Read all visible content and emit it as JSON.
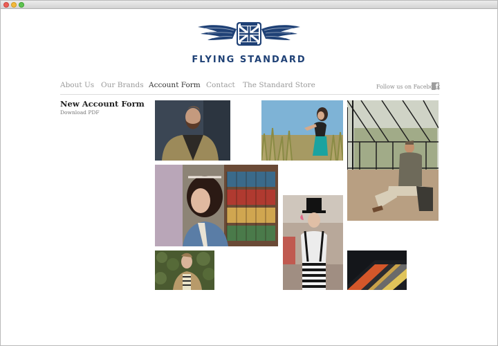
{
  "window": {
    "traffic_lights": [
      "close",
      "minimize",
      "zoom"
    ]
  },
  "site": {
    "name": "FLYING STANDARD",
    "logo": "winged-union-jack-emblem"
  },
  "nav": {
    "items": [
      {
        "label": "About Us",
        "active": false
      },
      {
        "label": "Our Brands",
        "active": false
      },
      {
        "label": "Account Form",
        "active": true
      },
      {
        "label": "Contact",
        "active": false
      },
      {
        "label": "The Standard Store",
        "active": false
      }
    ],
    "active_color": "#333333",
    "inactive_color": "#9a9a9a"
  },
  "social": {
    "follow_label": "Follow us on Facebook",
    "icon": "facebook-icon",
    "icon_glyph": "f"
  },
  "sidebar": {
    "title": "New Account Form",
    "download_label": "Download PDF"
  },
  "gallery": [
    {
      "name": "bearded-man-jacket-photo"
    },
    {
      "name": "woman-in-grass-photo"
    },
    {
      "name": "man-in-greenhouse-photo"
    },
    {
      "name": "woman-bob-haircut-photo"
    },
    {
      "name": "woman-top-hat-photo"
    },
    {
      "name": "man-in-hedge-photo"
    },
    {
      "name": "striped-fabric-photo"
    }
  ],
  "colors": {
    "brand_blue": "#1f4176",
    "background": "#ffffff"
  }
}
